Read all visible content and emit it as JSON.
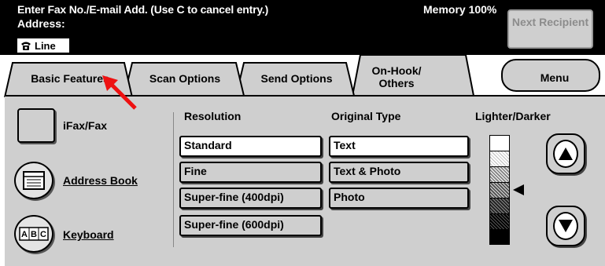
{
  "header": {
    "instruction": "Enter Fax No./E-mail Add. (Use C to cancel entry.)",
    "address_label": "Address:",
    "line_value": "Line",
    "memory": "Memory 100%",
    "next_recipient": "Next Recipient"
  },
  "tabs": [
    {
      "label": "Basic Features",
      "selected": true
    },
    {
      "label": "Scan Options",
      "selected": false
    },
    {
      "label": "Send Options",
      "selected": false
    },
    {
      "label": "On-Hook/ Others",
      "selected": false
    }
  ],
  "menu_label": "Menu",
  "side_buttons": {
    "ifax": "iFax/Fax",
    "address_book": "Address Book",
    "keyboard": "Keyboard"
  },
  "resolution": {
    "heading": "Resolution",
    "options": [
      "Standard",
      "Fine",
      "Super-fine (400dpi)",
      "Super-fine (600dpi)"
    ],
    "selected": "Standard"
  },
  "original_type": {
    "heading": "Original Type",
    "options": [
      "Text",
      "Text & Photo",
      "Photo"
    ],
    "selected": "Text"
  },
  "lighter_darker": {
    "heading": "Lighter/Darker",
    "levels": 7,
    "current_level": 4
  },
  "colors": {
    "header_bg": "#000000",
    "panel_bg": "#cfcfcf",
    "selected_bg": "#ffffff",
    "annotation_arrow": "#ee1111"
  }
}
